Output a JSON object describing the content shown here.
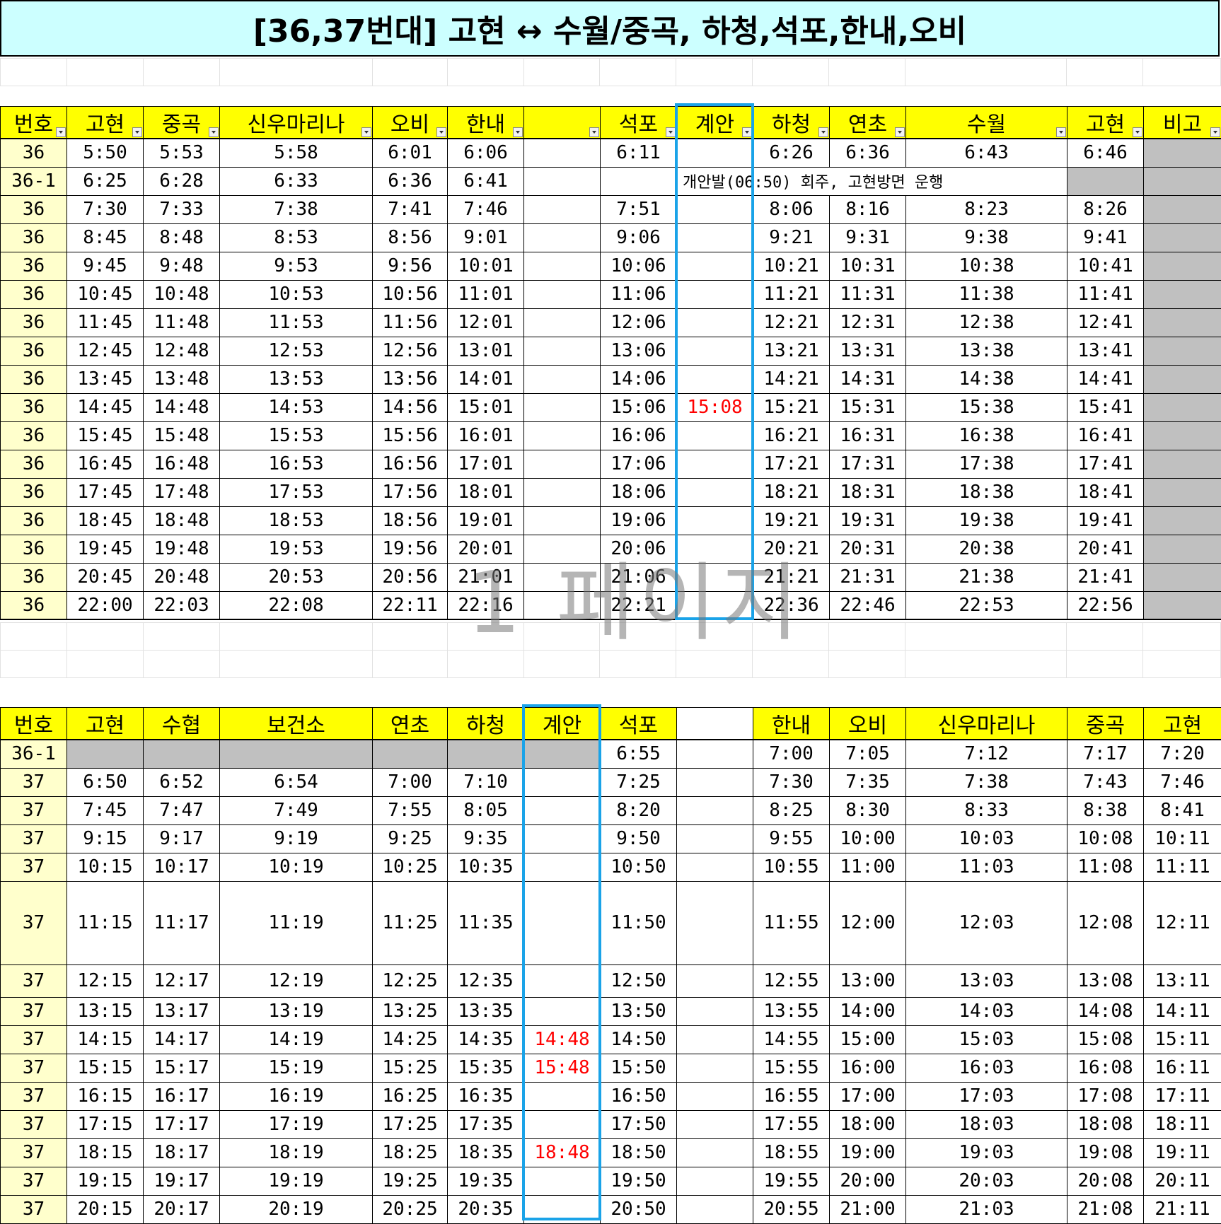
{
  "title": "[36,37번대] 고현 ↔ 수월/중곡, 하청,석포,한내,오비",
  "watermark": "1 페이지",
  "colors": {
    "header_bg": "#ffff00",
    "number_bg": "#ffffcc",
    "title_bg": "#ccffff",
    "highlight_box": "#1aa3e8",
    "red_text": "#ff0000",
    "gray_cell": "#c0c0c0"
  },
  "table1": {
    "headers": [
      "번호",
      "고현",
      "중곡",
      "신우마리나",
      "오비",
      "한내",
      "",
      "석포",
      "계안",
      "하청",
      "연초",
      "수월",
      "고현",
      "비고"
    ],
    "rows": [
      [
        "36",
        "5:50",
        "5:53",
        "5:58",
        "6:01",
        "6:06",
        "",
        "6:11",
        "",
        "6:26",
        "6:36",
        "6:43",
        "6:46",
        ""
      ],
      [
        "36",
        "7:30",
        "7:33",
        "7:38",
        "7:41",
        "7:46",
        "",
        "7:51",
        "",
        "8:06",
        "8:16",
        "8:23",
        "8:26",
        ""
      ],
      [
        "36",
        "8:45",
        "8:48",
        "8:53",
        "8:56",
        "9:01",
        "",
        "9:06",
        "",
        "9:21",
        "9:31",
        "9:38",
        "9:41",
        ""
      ],
      [
        "36",
        "9:45",
        "9:48",
        "9:53",
        "9:56",
        "10:01",
        "",
        "10:06",
        "",
        "10:21",
        "10:31",
        "10:38",
        "10:41",
        ""
      ],
      [
        "36",
        "10:45",
        "10:48",
        "10:53",
        "10:56",
        "11:01",
        "",
        "11:06",
        "",
        "11:21",
        "11:31",
        "11:38",
        "11:41",
        ""
      ],
      [
        "36",
        "11:45",
        "11:48",
        "11:53",
        "11:56",
        "12:01",
        "",
        "12:06",
        "",
        "12:21",
        "12:31",
        "12:38",
        "12:41",
        ""
      ],
      [
        "36",
        "12:45",
        "12:48",
        "12:53",
        "12:56",
        "13:01",
        "",
        "13:06",
        "",
        "13:21",
        "13:31",
        "13:38",
        "13:41",
        ""
      ],
      [
        "36",
        "13:45",
        "13:48",
        "13:53",
        "13:56",
        "14:01",
        "",
        "14:06",
        "",
        "14:21",
        "14:31",
        "14:38",
        "14:41",
        ""
      ],
      [
        "36",
        "14:45",
        "14:48",
        "14:53",
        "14:56",
        "15:01",
        "",
        "15:06",
        "15:08",
        "15:21",
        "15:31",
        "15:38",
        "15:41",
        ""
      ],
      [
        "36",
        "15:45",
        "15:48",
        "15:53",
        "15:56",
        "16:01",
        "",
        "16:06",
        "",
        "16:21",
        "16:31",
        "16:38",
        "16:41",
        ""
      ],
      [
        "36",
        "16:45",
        "16:48",
        "16:53",
        "16:56",
        "17:01",
        "",
        "17:06",
        "",
        "17:21",
        "17:31",
        "17:38",
        "17:41",
        ""
      ],
      [
        "36",
        "17:45",
        "17:48",
        "17:53",
        "17:56",
        "18:01",
        "",
        "18:06",
        "",
        "18:21",
        "18:31",
        "18:38",
        "18:41",
        ""
      ],
      [
        "36",
        "18:45",
        "18:48",
        "18:53",
        "18:56",
        "19:01",
        "",
        "19:06",
        "",
        "19:21",
        "19:31",
        "19:38",
        "19:41",
        ""
      ],
      [
        "36",
        "19:45",
        "19:48",
        "19:53",
        "19:56",
        "20:01",
        "",
        "20:06",
        "",
        "20:21",
        "20:31",
        "20:38",
        "20:41",
        ""
      ],
      [
        "36",
        "20:45",
        "20:48",
        "20:53",
        "20:56",
        "21:01",
        "",
        "21:06",
        "",
        "21:21",
        "21:31",
        "21:38",
        "21:41",
        ""
      ],
      [
        "36",
        "22:00",
        "22:03",
        "22:08",
        "22:11",
        "22:16",
        "",
        "22:21",
        "",
        "22:36",
        "22:46",
        "22:53",
        "22:56",
        ""
      ]
    ],
    "special_row": {
      "num": "36-1",
      "times": [
        "6:25",
        "6:28",
        "6:33",
        "6:36",
        "6:41"
      ],
      "note": "개안발(06:50) 회주, 고현방면 운행"
    }
  },
  "table2": {
    "headers": [
      "번호",
      "고현",
      "수협",
      "보건소",
      "연초",
      "하청",
      "계안",
      "석포",
      "",
      "한내",
      "오비",
      "신우마리나",
      "중곡",
      "고현"
    ],
    "first_row": [
      "36-1",
      "",
      "",
      "",
      "",
      "",
      "",
      "6:55",
      "",
      "7:00",
      "7:05",
      "7:12",
      "7:17",
      "7:20"
    ],
    "rows": [
      [
        "37",
        "6:50",
        "6:52",
        "6:54",
        "7:00",
        "7:10",
        "",
        "7:25",
        "",
        "7:30",
        "7:35",
        "7:38",
        "7:43",
        "7:46"
      ],
      [
        "37",
        "7:45",
        "7:47",
        "7:49",
        "7:55",
        "8:05",
        "",
        "8:20",
        "",
        "8:25",
        "8:30",
        "8:33",
        "8:38",
        "8:41"
      ],
      [
        "37",
        "9:15",
        "9:17",
        "9:19",
        "9:25",
        "9:35",
        "",
        "9:50",
        "",
        "9:55",
        "10:00",
        "10:03",
        "10:08",
        "10:11"
      ],
      [
        "37",
        "10:15",
        "10:17",
        "10:19",
        "10:25",
        "10:35",
        "",
        "10:50",
        "",
        "10:55",
        "11:00",
        "11:03",
        "11:08",
        "11:11"
      ],
      [
        "37",
        "11:15",
        "11:17",
        "11:19",
        "11:25",
        "11:35",
        "",
        "11:50",
        "",
        "11:55",
        "12:00",
        "12:03",
        "12:08",
        "12:11"
      ],
      [
        "37",
        "12:15",
        "12:17",
        "12:19",
        "12:25",
        "12:35",
        "",
        "12:50",
        "",
        "12:55",
        "13:00",
        "13:03",
        "13:08",
        "13:11"
      ],
      [
        "37",
        "13:15",
        "13:17",
        "13:19",
        "13:25",
        "13:35",
        "",
        "13:50",
        "",
        "13:55",
        "14:00",
        "14:03",
        "14:08",
        "14:11"
      ],
      [
        "37",
        "14:15",
        "14:17",
        "14:19",
        "14:25",
        "14:35",
        "14:48",
        "14:50",
        "",
        "14:55",
        "15:00",
        "15:03",
        "15:08",
        "15:11"
      ],
      [
        "37",
        "15:15",
        "15:17",
        "15:19",
        "15:25",
        "15:35",
        "15:48",
        "15:50",
        "",
        "15:55",
        "16:00",
        "16:03",
        "16:08",
        "16:11"
      ],
      [
        "37",
        "16:15",
        "16:17",
        "16:19",
        "16:25",
        "16:35",
        "",
        "16:50",
        "",
        "16:55",
        "17:00",
        "17:03",
        "17:08",
        "17:11"
      ],
      [
        "37",
        "17:15",
        "17:17",
        "17:19",
        "17:25",
        "17:35",
        "",
        "17:50",
        "",
        "17:55",
        "18:00",
        "18:03",
        "18:08",
        "18:11"
      ],
      [
        "37",
        "18:15",
        "18:17",
        "18:19",
        "18:25",
        "18:35",
        "18:48",
        "18:50",
        "",
        "18:55",
        "19:00",
        "19:03",
        "19:08",
        "19:11"
      ],
      [
        "37",
        "19:15",
        "19:17",
        "19:19",
        "19:25",
        "19:35",
        "",
        "19:50",
        "",
        "19:55",
        "20:00",
        "20:03",
        "20:08",
        "20:11"
      ],
      [
        "37",
        "20:15",
        "20:17",
        "20:19",
        "20:25",
        "20:35",
        "",
        "20:50",
        "",
        "20:55",
        "21:00",
        "21:03",
        "21:08",
        "21:11"
      ]
    ]
  }
}
